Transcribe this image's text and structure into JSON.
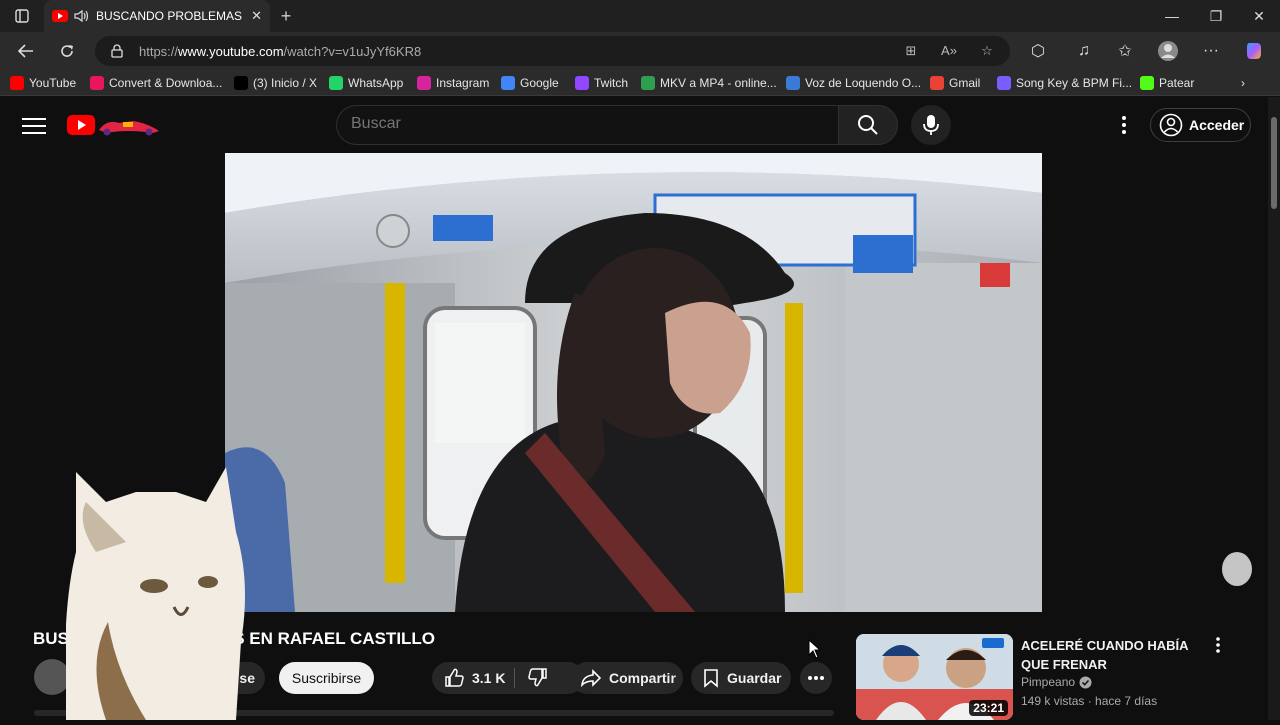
{
  "browser": {
    "tab_title": "BUSCANDO PROBLEMAS EN RAFAEL CASTILLO",
    "new_tab_symbol": "+",
    "url_prefix": "https://",
    "url_host": "www.youtube.com",
    "url_path": "/watch?v=v1uJyYf6KR8",
    "window_controls": {
      "minimize": "—",
      "maximize": "❐",
      "close": "✕"
    }
  },
  "bookmarks": [
    {
      "label": "YouTube",
      "icon": "youtube-icon",
      "color": "#ff0000"
    },
    {
      "label": "Convert & Downloa...",
      "icon": "download-icon",
      "color": "#e8175d"
    },
    {
      "label": "(3) Inicio / X",
      "icon": "x-icon",
      "color": "#000000"
    },
    {
      "label": "WhatsApp",
      "icon": "whatsapp-icon",
      "color": "#25d366"
    },
    {
      "label": "Instagram",
      "icon": "instagram-icon",
      "color": "#d6249f"
    },
    {
      "label": "Google",
      "icon": "google-icon",
      "color": "#4285f4"
    },
    {
      "label": "Twitch",
      "icon": "twitch-icon",
      "color": "#9146ff"
    },
    {
      "label": "MKV a MP4 - online...",
      "icon": "mkv-icon",
      "color": "#2e9e4f"
    },
    {
      "label": "Voz de Loquendo O...",
      "icon": "audio-bars-icon",
      "color": "#3b7bd8"
    },
    {
      "label": "Gmail",
      "icon": "gmail-icon",
      "color": "#ea4335"
    },
    {
      "label": "Song Key & BPM Fi...",
      "icon": "song-key-icon",
      "color": "#7a5cff"
    },
    {
      "label": "Patear",
      "icon": "k-icon",
      "color": "#53fc18"
    }
  ],
  "youtube": {
    "search_placeholder": "Buscar",
    "signin_label": "Acceder",
    "video_title": "BUSCANDO PROBLEMAS EN RAFAEL CASTILLO",
    "subscribe_behind_label": "se",
    "subscribe_label": "Suscribirse",
    "like_count": "3.1 K",
    "share_label": "Compartir",
    "save_label": "Guardar",
    "related": {
      "title": "ACELERÉ CUANDO HABÍA QUE FRENAR",
      "channel": "Pimpeano",
      "meta": "149 k vistas · hace 7 días",
      "duration": "23:21"
    }
  },
  "colors": {
    "accent": "#ff0000",
    "background": "#0f0f0f"
  }
}
